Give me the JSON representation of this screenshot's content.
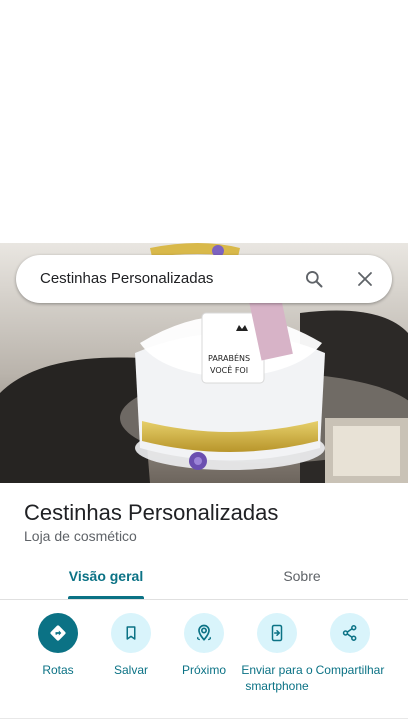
{
  "search": {
    "query": "Cestinhas Personalizadas"
  },
  "place": {
    "title": "Cestinhas Personalizadas",
    "category": "Loja de cosmético"
  },
  "photo": {
    "mug_text_line1": "PARABÉNS",
    "mug_text_line2": "VOCÊ FOI"
  },
  "tabs": [
    {
      "label": "Visão geral",
      "active": true
    },
    {
      "label": "Sobre",
      "active": false
    }
  ],
  "actions": [
    {
      "label": "Rotas",
      "icon": "directions-icon"
    },
    {
      "label": "Salvar",
      "icon": "bookmark-icon"
    },
    {
      "label": "Próximo",
      "icon": "nearby-icon"
    },
    {
      "label": "Enviar para o smartphone",
      "icon": "send-to-phone-icon"
    },
    {
      "label": "Compartilhar",
      "icon": "share-icon"
    }
  ],
  "colors": {
    "accent": "#0b7285",
    "chip_bg": "#d9f4fb"
  }
}
